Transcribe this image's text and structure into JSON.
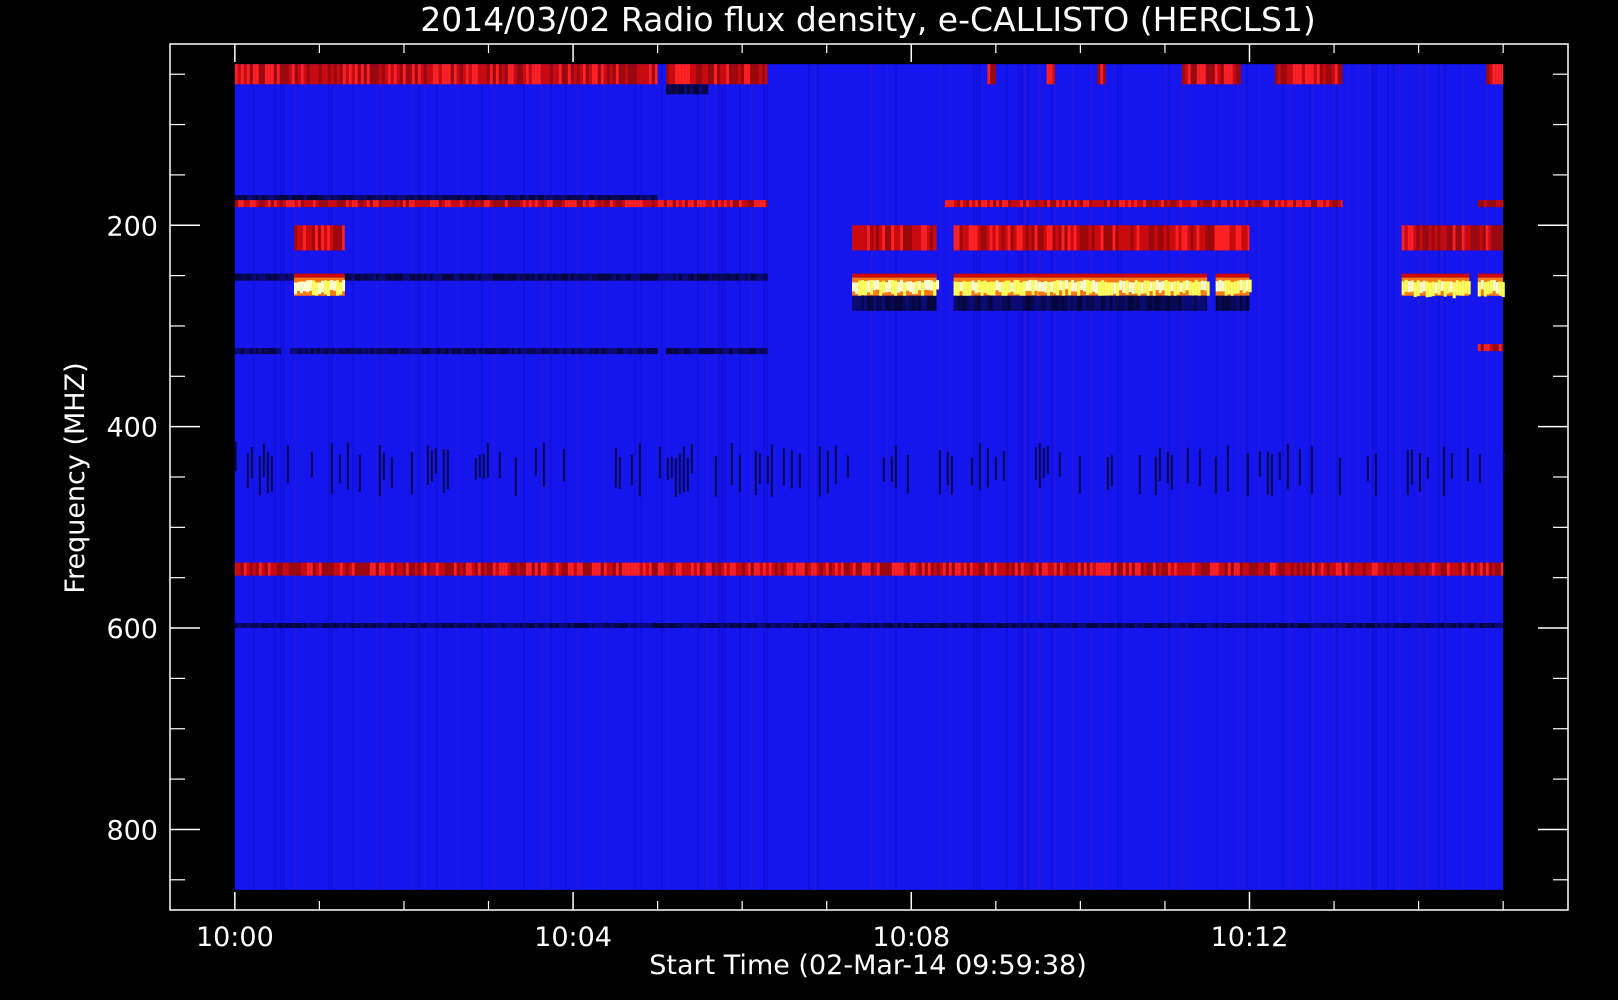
{
  "chart_data": {
    "type": "heatmap",
    "title": "2014/03/02  Radio flux density, e-CALLISTO (HERCLS1)",
    "xlabel": "Start Time (02-Mar-14 09:59:38)",
    "ylabel": "Frequency (MHZ)",
    "x_tick_labels": [
      "10:00",
      "10:04",
      "10:08",
      "10:12"
    ],
    "x_tick_minutes": [
      0,
      4,
      8,
      12
    ],
    "x_range_minutes": [
      -0.767,
      15.767
    ],
    "data_x_range_minutes": [
      0.0,
      15.0
    ],
    "y_tick_labels": [
      "200",
      "400",
      "600",
      "800"
    ],
    "y_tick_values": [
      200,
      400,
      600,
      800
    ],
    "y_range": [
      20,
      880
    ],
    "y_inverted": true,
    "data_y_range": [
      40,
      860
    ],
    "background_color": "#1515ee",
    "colors": {
      "background": "#000000",
      "axes": "#ffffff",
      "base": "#1515ee",
      "dark": "#080850",
      "red": "#cc0a0a",
      "bright_red": "#ff2020",
      "orange": "#ff7a10",
      "yellow": "#ffff60",
      "white_hot": "#ffffd0"
    },
    "features": [
      {
        "band_mhz": [
          40,
          60
        ],
        "level": "red",
        "segments_minutes": [
          [
            0.0,
            5.0
          ],
          [
            5.1,
            6.3
          ]
        ]
      },
      {
        "band_mhz": [
          40,
          60
        ],
        "level": "red",
        "segments_minutes": [
          [
            8.9,
            9.0
          ],
          [
            9.6,
            9.7
          ],
          [
            10.2,
            10.3
          ],
          [
            11.2,
            11.9
          ],
          [
            12.3,
            13.1
          ],
          [
            14.8,
            15.0
          ]
        ]
      },
      {
        "band_mhz": [
          60,
          70
        ],
        "level": "dark",
        "segments_minutes": [
          [
            5.1,
            5.6
          ]
        ]
      },
      {
        "band_mhz": [
          170,
          175
        ],
        "level": "dark",
        "segments_minutes": [
          [
            0.0,
            5.0
          ]
        ]
      },
      {
        "band_mhz": [
          175,
          182
        ],
        "level": "red",
        "segments_minutes": [
          [
            0.0,
            6.3
          ],
          [
            8.4,
            13.1
          ],
          [
            14.7,
            15.0
          ]
        ]
      },
      {
        "band_mhz": [
          200,
          225
        ],
        "level": "red",
        "segments_minutes": [
          [
            0.7,
            1.3
          ],
          [
            7.3,
            8.3
          ],
          [
            8.5,
            12.0
          ],
          [
            13.8,
            15.0
          ]
        ]
      },
      {
        "band_mhz": [
          248,
          255
        ],
        "level": "dark",
        "segments_minutes": [
          [
            0.0,
            6.3
          ]
        ]
      },
      {
        "band_mhz": [
          252,
          270
        ],
        "level": "yellow",
        "segments_minutes": [
          [
            0.7,
            1.3
          ],
          [
            7.3,
            8.3
          ],
          [
            8.5,
            9.5
          ],
          [
            9.5,
            10.5
          ],
          [
            10.5,
            11.5
          ],
          [
            11.6,
            12.0
          ],
          [
            13.8,
            14.6
          ],
          [
            14.7,
            15.0
          ]
        ]
      },
      {
        "band_mhz": [
          270,
          285
        ],
        "level": "dark",
        "segments_minutes": [
          [
            7.3,
            8.3
          ],
          [
            8.5,
            11.5
          ],
          [
            11.6,
            12.0
          ]
        ]
      },
      {
        "band_mhz": [
          322,
          328
        ],
        "level": "dark",
        "segments_minutes": [
          [
            0.0,
            0.55
          ],
          [
            0.65,
            5.0
          ],
          [
            5.1,
            6.3
          ]
        ]
      },
      {
        "band_mhz": [
          318,
          325
        ],
        "level": "red",
        "segments_minutes": [
          [
            14.7,
            15.0
          ]
        ]
      },
      {
        "band_mhz": [
          415,
          470
        ],
        "level": "dark_streaks",
        "segments_minutes": [
          [
            0.0,
            15.0
          ]
        ]
      },
      {
        "band_mhz": [
          535,
          548
        ],
        "level": "red",
        "segments_minutes": [
          [
            0.0,
            15.0
          ]
        ]
      },
      {
        "band_mhz": [
          595,
          600
        ],
        "level": "dark",
        "segments_minutes": [
          [
            0.0,
            15.0
          ]
        ]
      }
    ]
  }
}
